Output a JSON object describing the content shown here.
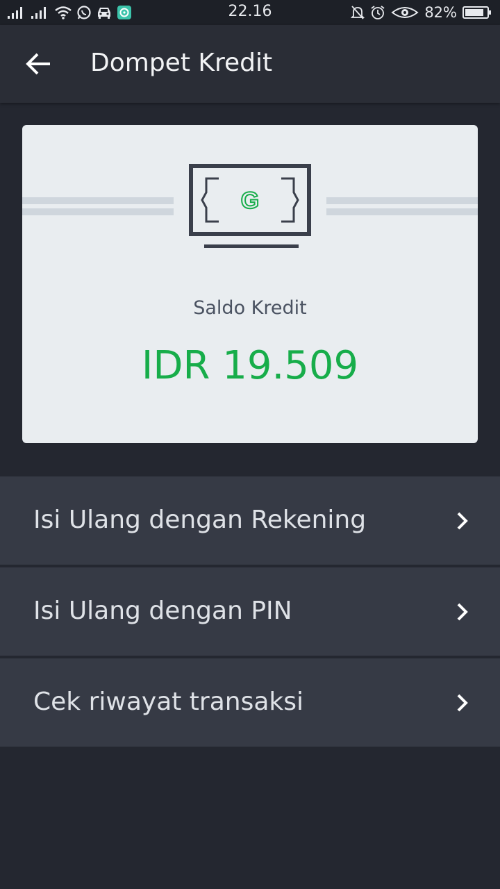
{
  "status_bar": {
    "time": "22.16",
    "battery": "82%",
    "icons": [
      "signal-icon",
      "signal-icon",
      "wifi-icon",
      "whatsapp-icon",
      "car-icon",
      "app-notification-icon",
      "bell-off-icon",
      "alarm-icon",
      "eye-icon",
      "battery-icon"
    ]
  },
  "header": {
    "title": "Dompet Kredit",
    "back_icon": "back-arrow-icon"
  },
  "wallet_card": {
    "label": "Saldo Kredit",
    "amount": "IDR 19.509",
    "illustration_letter": "G",
    "accent_color": "#17ad4a"
  },
  "menu": {
    "items": [
      {
        "label": "Isi Ulang dengan Rekening",
        "icon": "chevron-right-icon"
      },
      {
        "label": "Isi Ulang dengan PIN",
        "icon": "chevron-right-icon"
      },
      {
        "label": "Cek riwayat transaksi",
        "icon": "chevron-right-icon"
      }
    ]
  }
}
